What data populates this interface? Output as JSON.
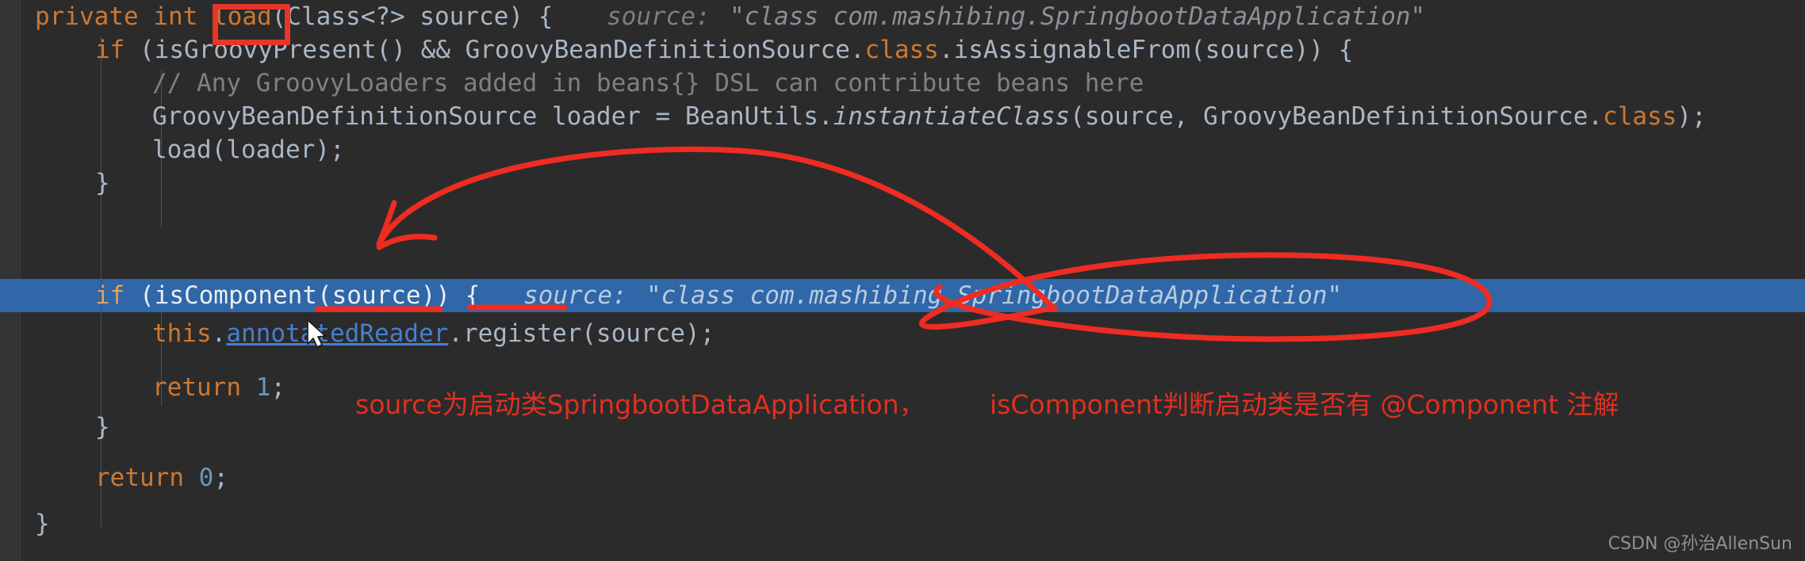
{
  "editor": {
    "background_color": "#2b2b2b",
    "gutter_color": "#313335",
    "highlight_row_color": "#2f67a8",
    "annotation_color": "#e03020",
    "box_color": "#e8352a"
  },
  "code": {
    "line1": {
      "kw_private": "private",
      "sp1": " ",
      "kw_int": "int",
      "sp2": " ",
      "method": "load",
      "sig": "(Class<?> source) {",
      "hint_label": "source:",
      "hint_value": "\"class com.mashibing.SpringbootDataApplication\""
    },
    "line2": {
      "kw_if": "if",
      "text_a": " (isGroovyPresent() && GroovyBeanDefinitionSource.",
      "kw_class": "class",
      "text_b": ".isAssignableFrom(source)) {"
    },
    "line3": {
      "comment": "// Any GroovyLoaders added in beans{} DSL can contribute beans here"
    },
    "line4": {
      "text_a": "GroovyBeanDefinitionSource loader = BeanUtils.",
      "static_call": "instantiateClass",
      "text_b": "(source, GroovyBeanDefinitionSource.",
      "kw_class": "class",
      "text_c": ");"
    },
    "line5": {
      "text": "load(loader);"
    },
    "line6": {
      "text": "}"
    },
    "line7": {
      "kw_if": "if",
      "text_a": " (isComponent(source)) {",
      "hint_label": "source:",
      "hint_value": "\"class com.mashibing.SpringbootDataApplication\""
    },
    "line8": {
      "kw_this": "this",
      "dot": ".",
      "field": "annotatedReader",
      "text_b": ".register(source);"
    },
    "line9": {
      "kw_return": "return",
      "sp": " ",
      "value": "1",
      "semi": ";"
    },
    "line10": {
      "text": "}"
    },
    "line11": {
      "kw_return": "return",
      "sp": " ",
      "value": "0",
      "semi": ";"
    },
    "line12": {
      "text": "}"
    }
  },
  "annotation": {
    "part1": "source为启动类SpringbootDataApplication，",
    "part2": "isComponent判断启动类是否有 @Component 注解"
  },
  "watermark": {
    "text": "CSDN @孙治AllenSun"
  },
  "ink": {
    "description": "red hand-drawn arrow and ellipse",
    "arrow_name": "red-arrow-annotation",
    "ellipse_name": "red-ellipse-annotation"
  }
}
